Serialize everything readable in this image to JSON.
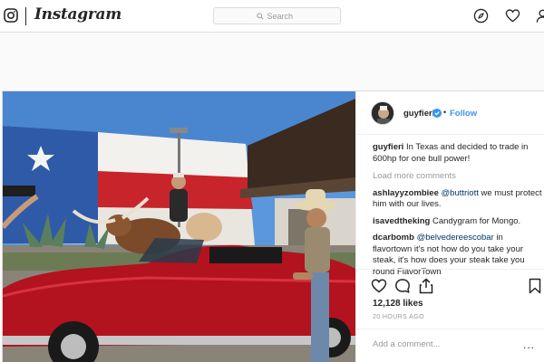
{
  "nav": {
    "brand": "Instagram",
    "search_placeholder": "Search",
    "icons": [
      "instagram-glyph-icon",
      "search-icon",
      "compass-icon",
      "heart-icon",
      "profile-icon"
    ]
  },
  "post": {
    "username": "guyfieri",
    "follow_label": "Follow",
    "separator": "•",
    "caption": {
      "user": "guyfieri",
      "text": "In Texas and decided to trade in 600hp for one bull power!"
    },
    "load_more": "Load more comments",
    "comments": [
      {
        "user": "ashlayyzombiee",
        "mention": "@buttriott",
        "text": "we must protect him with our lives."
      },
      {
        "user": "isavedtheking",
        "mention": "",
        "text": "Candygram for Mongo."
      },
      {
        "user": "dcarbomb",
        "mention": "@belvedereescobar",
        "text": "in flavortown it's not how do you take your steak, it's how does your steak take you round FlavorTown"
      }
    ],
    "likes": "12,128 likes",
    "time": "20 HOURS AGO",
    "add_comment_placeholder": "Add a comment...",
    "more": "...",
    "action_icons": [
      "heart-icon",
      "comment-icon",
      "share-icon",
      "bookmark-icon"
    ]
  },
  "colors": {
    "link": "#3897f0",
    "border": "#dbdbdb",
    "verified": "#3897f0",
    "car_red": "#b3121f",
    "sky": "#4f8fd6"
  }
}
